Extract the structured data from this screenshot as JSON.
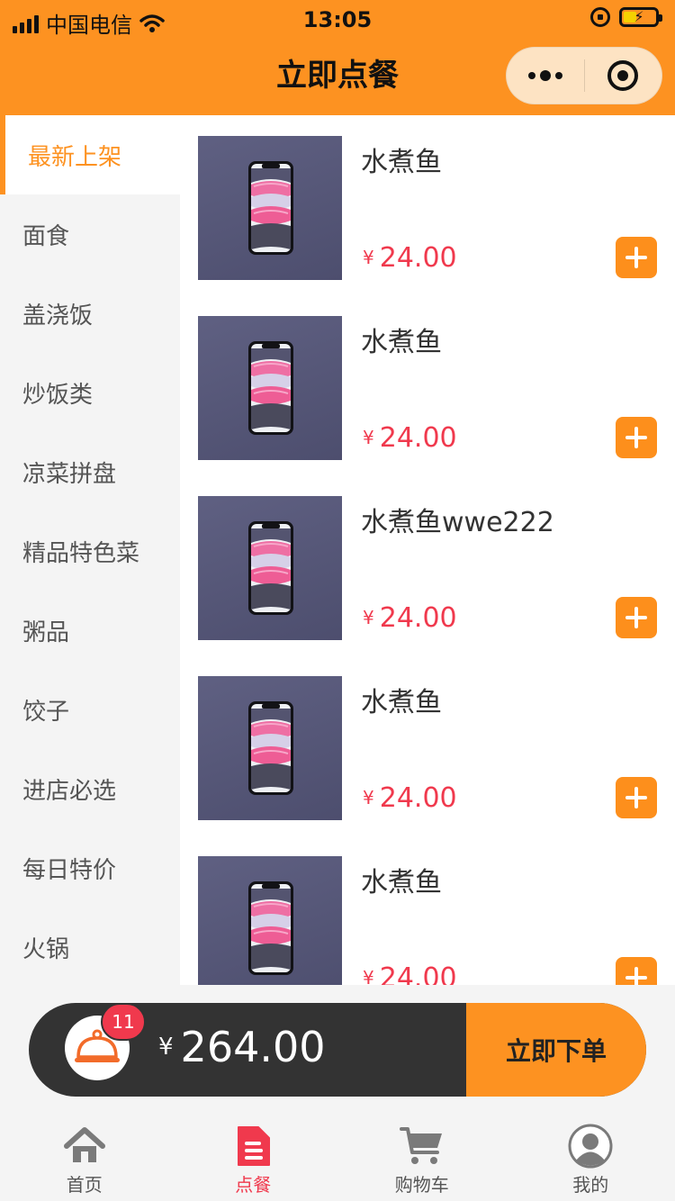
{
  "status_bar": {
    "carrier": "中国电信",
    "time": "13:05"
  },
  "nav": {
    "title": "立即点餐"
  },
  "categories": [
    {
      "label": "最新上架",
      "active": true
    },
    {
      "label": "面食"
    },
    {
      "label": "盖浇饭"
    },
    {
      "label": "炒饭类"
    },
    {
      "label": "凉菜拼盘"
    },
    {
      "label": "精品特色菜"
    },
    {
      "label": "粥品"
    },
    {
      "label": "饺子"
    },
    {
      "label": "进店必选"
    },
    {
      "label": "每日特价"
    },
    {
      "label": "火锅"
    }
  ],
  "products": [
    {
      "name": "水煮鱼",
      "currency": "¥",
      "price": "24.00"
    },
    {
      "name": "水煮鱼",
      "currency": "¥",
      "price": "24.00"
    },
    {
      "name": "水煮鱼wwe222",
      "currency": "¥",
      "price": "24.00"
    },
    {
      "name": "水煮鱼",
      "currency": "¥",
      "price": "24.00"
    },
    {
      "name": "水煮鱼",
      "currency": "¥",
      "price": "24.00"
    }
  ],
  "cart": {
    "badge": "11",
    "currency": "¥",
    "total": "264.00",
    "checkout_label": "立即下单"
  },
  "tabs": [
    {
      "label": "首页",
      "icon": "home-icon"
    },
    {
      "label": "点餐",
      "icon": "order-document-icon",
      "active": true
    },
    {
      "label": "购物车",
      "icon": "shopping-cart-icon"
    },
    {
      "label": "我的",
      "icon": "user-profile-icon"
    }
  ],
  "colors": {
    "accent": "#fd9221",
    "price": "#f0394d",
    "cart_bar": "#333333"
  }
}
